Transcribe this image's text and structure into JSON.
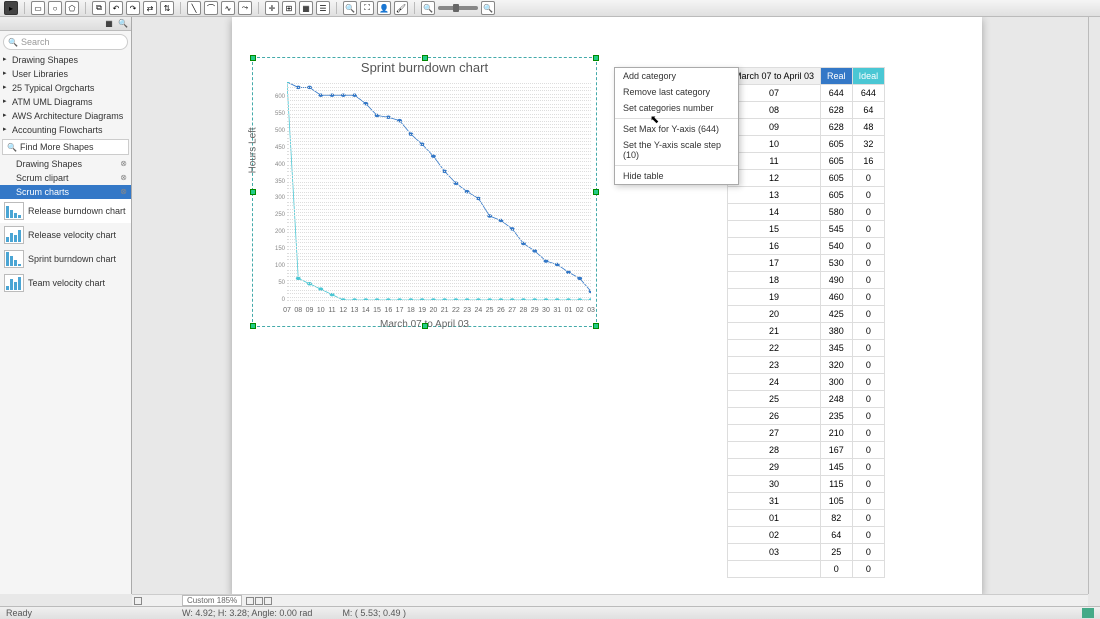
{
  "toolbar": {},
  "search_placeholder": "Search",
  "tree": [
    "Drawing Shapes",
    "User Libraries",
    "25 Typical Orgcharts",
    "ATM UML Diagrams",
    "AWS Architecture Diagrams",
    "Accounting Flowcharts"
  ],
  "find_more_shapes": "Find More Shapes",
  "subsections": [
    "Drawing Shapes",
    "Scrum clipart",
    "Scrum charts"
  ],
  "shapes": [
    "Release burndown chart",
    "Release velocity chart",
    "Sprint burndown chart",
    "Team velocity chart"
  ],
  "context_menu": [
    "Add category",
    "Remove last category",
    "Set categories number",
    "Set Max for Y-axis (644)",
    "Set the Y-axis scale step (10)",
    "Hide table"
  ],
  "table_headers": {
    "cat": "March 07 to April 03",
    "real": "Real",
    "ideal": "Ideal"
  },
  "status": {
    "ready": "Ready",
    "zoom": "Custom 185%",
    "whr": "W: 4.92; H: 3.28; Angle: 0.00 rad",
    "mouse": "M: ( 5.53; 0.49 )"
  },
  "chart_data": {
    "type": "line",
    "title": "Sprint burndown chart",
    "xlabel": "March 07 to April 03",
    "ylabel": "Hours Left",
    "ylim": [
      0,
      644
    ],
    "ystep": 10,
    "categories": [
      "07",
      "08",
      "09",
      "10",
      "11",
      "12",
      "13",
      "14",
      "15",
      "16",
      "17",
      "18",
      "19",
      "20",
      "21",
      "22",
      "23",
      "24",
      "25",
      "26",
      "27",
      "28",
      "29",
      "30",
      "31",
      "01",
      "02",
      "03"
    ],
    "series": [
      {
        "name": "Real",
        "values": [
          644,
          628,
          628,
          605,
          605,
          605,
          605,
          580,
          545,
          540,
          530,
          490,
          460,
          425,
          380,
          345,
          320,
          300,
          248,
          235,
          210,
          167,
          145,
          115,
          105,
          82,
          64,
          25
        ]
      },
      {
        "name": "Ideal",
        "values": [
          644,
          64,
          48,
          32,
          16,
          0,
          0,
          0,
          0,
          0,
          0,
          0,
          0,
          0,
          0,
          0,
          0,
          0,
          0,
          0,
          0,
          0,
          0,
          0,
          0,
          0,
          0,
          0
        ]
      }
    ],
    "last_blank_row": [
      0,
      0
    ]
  }
}
